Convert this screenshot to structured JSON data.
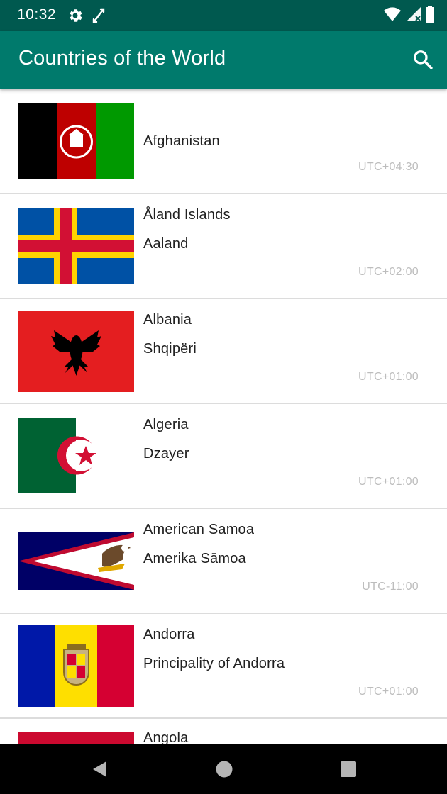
{
  "status_bar": {
    "time": "10:32"
  },
  "app_bar": {
    "title": "Countries of the World"
  },
  "countries": [
    {
      "name": "Afghanistan",
      "native": "",
      "timezone": "UTC+04:30",
      "flag": "afghanistan-flag"
    },
    {
      "name": "Åland Islands",
      "native": "Aaland",
      "timezone": "UTC+02:00",
      "flag": "aland-flag"
    },
    {
      "name": "Albania",
      "native": "Shqipëri",
      "timezone": "UTC+01:00",
      "flag": "albania-flag"
    },
    {
      "name": "Algeria",
      "native": "Dzayer",
      "timezone": "UTC+01:00",
      "flag": "algeria-flag"
    },
    {
      "name": "American Samoa",
      "native": "Amerika Sāmoa",
      "timezone": "UTC-11:00",
      "flag": "american-samoa-flag"
    },
    {
      "name": "Andorra",
      "native": "Principality of Andorra",
      "timezone": "UTC+01:00",
      "flag": "andorra-flag"
    },
    {
      "name": "Angola",
      "native": "",
      "timezone": "",
      "flag": "angola-flag"
    }
  ]
}
